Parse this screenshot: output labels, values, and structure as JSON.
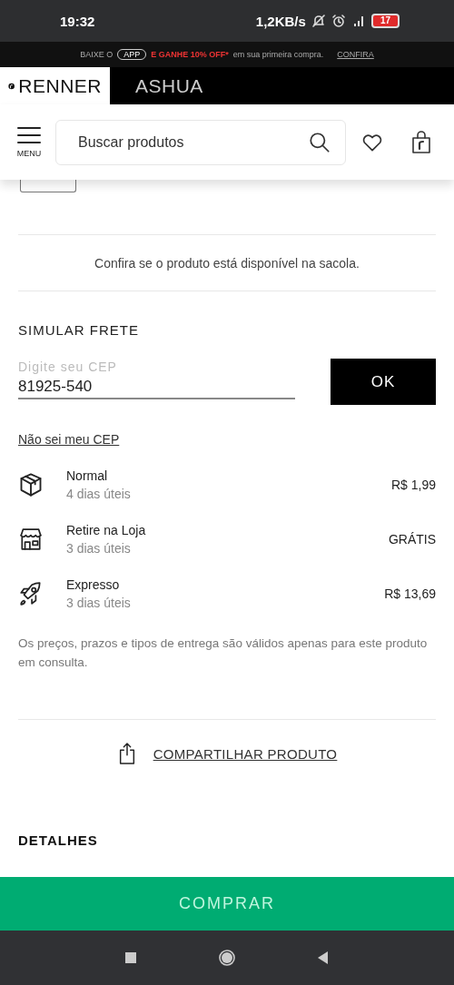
{
  "status_bar": {
    "time": "19:32",
    "speed": "1,2KB/s",
    "battery": "17"
  },
  "promo": {
    "lead": "BAIXE O",
    "app": "APP",
    "offer": "E GANHE 10% OFF*",
    "rest": "em sua primeira compra.",
    "link": "CONFIRA"
  },
  "brands": [
    {
      "label": "RENNER",
      "selected": true
    },
    {
      "label": "ASHUA",
      "selected": false
    }
  ],
  "header": {
    "menu": "MENU",
    "search": {
      "placeholder": "Buscar produtos"
    }
  },
  "availability": "Confira se o produto está disponível na sacola.",
  "shipping": {
    "title": "SIMULAR FRETE",
    "cep": {
      "label": "Digite seu CEP",
      "value": "81925-540"
    },
    "ok": "OK",
    "help_link": "Não sei meu CEP",
    "options": [
      {
        "kind": "box",
        "name": "Normal",
        "time": "4 dias úteis",
        "price": "R$ 1,99"
      },
      {
        "kind": "store",
        "name": "Retire na Loja",
        "time": "3 dias úteis",
        "price": "GRÁTIS"
      },
      {
        "kind": "rocket",
        "name": "Expresso",
        "time": "3 dias úteis",
        "price": "R$ 13,69"
      }
    ],
    "note": "Os preços, prazos e tipos de entrega são válidos apenas para este produto em consulta."
  },
  "share": "COMPARTILHAR PRODUTO",
  "details_heading": "DETALHES",
  "buy_button": "COMPRAR"
}
